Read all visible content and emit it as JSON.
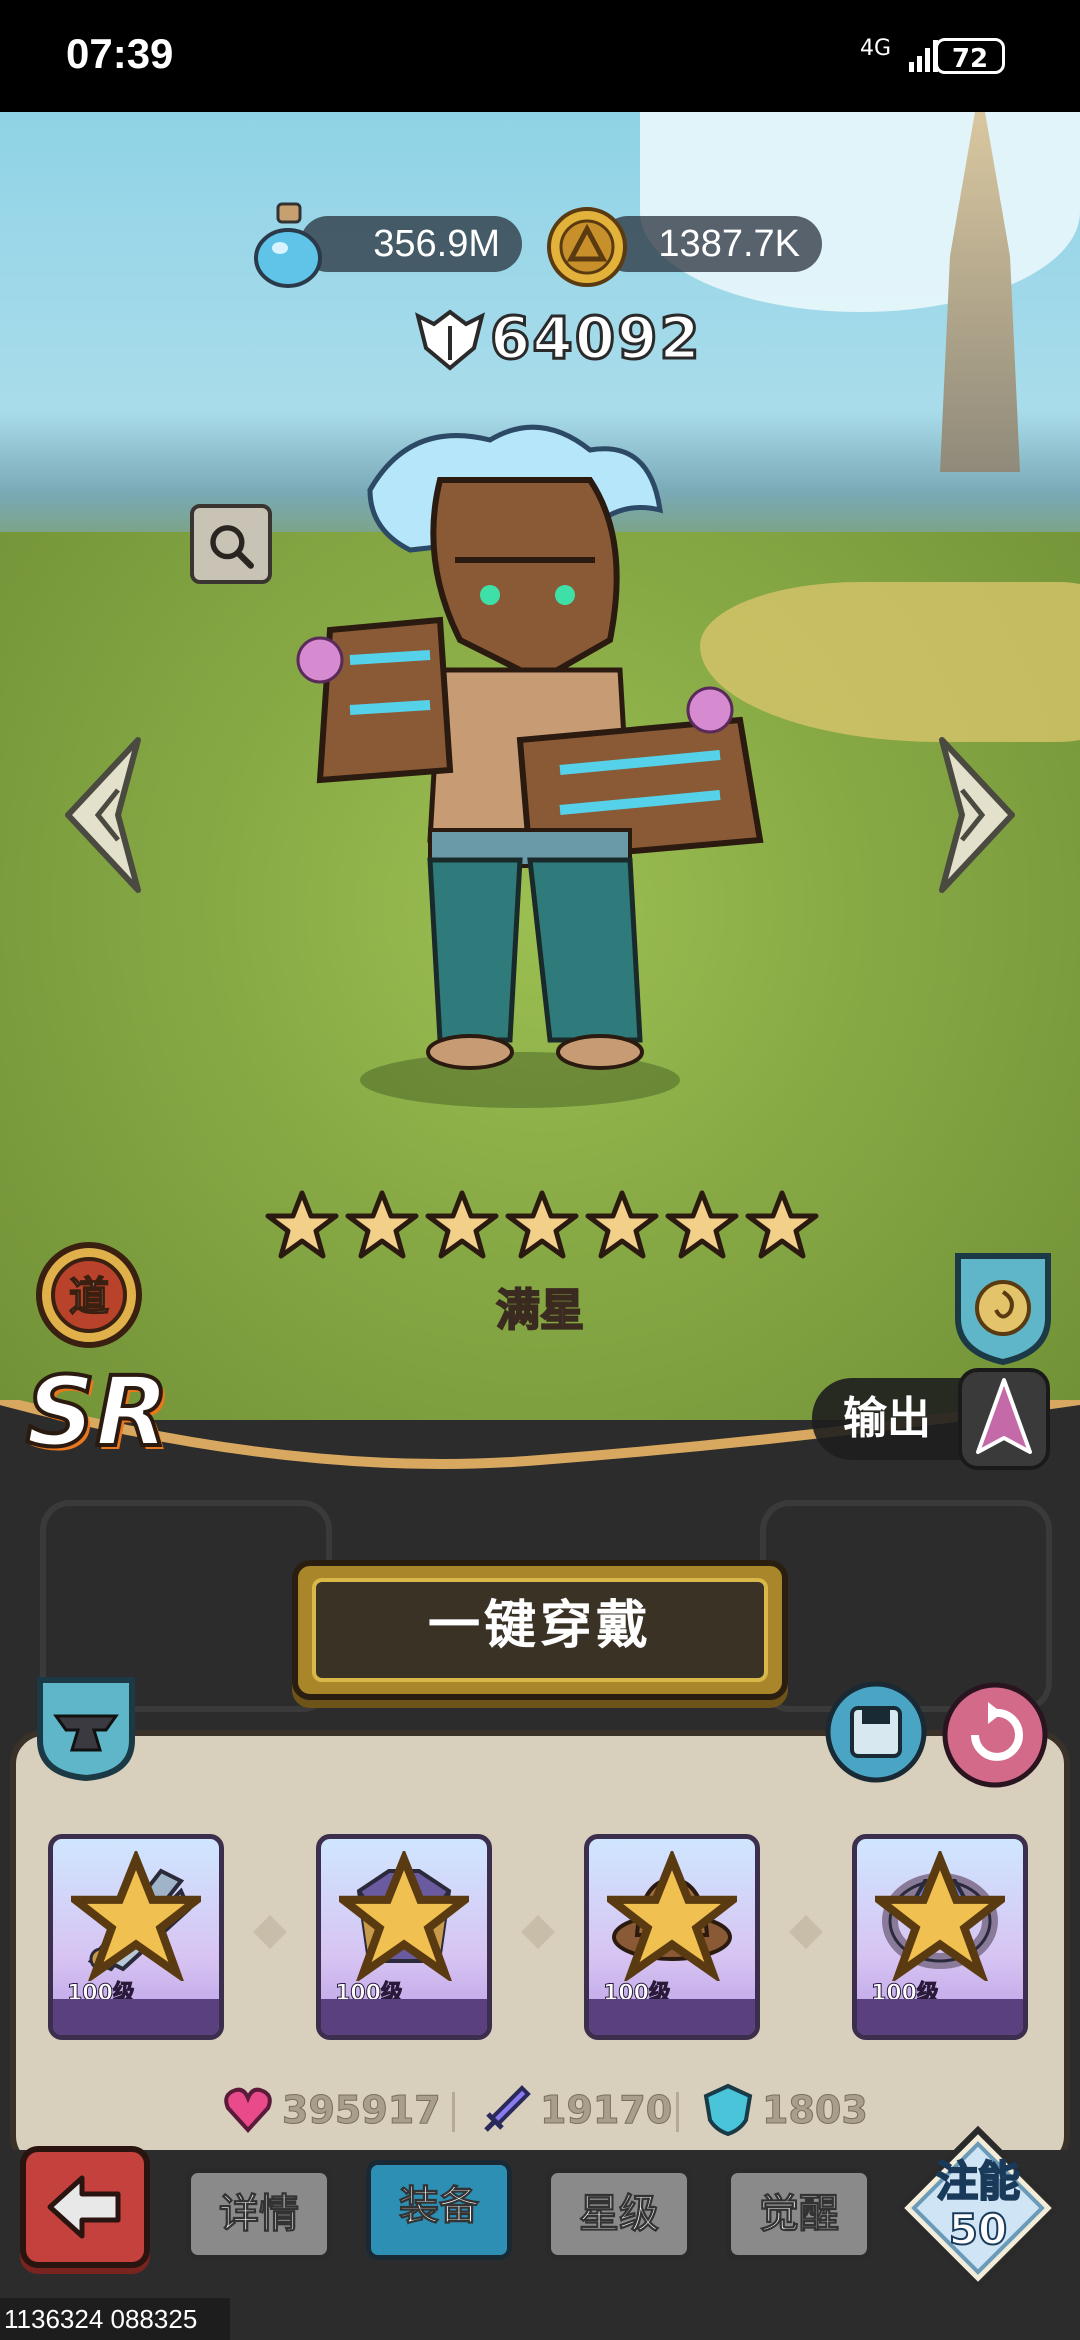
{
  "status_bar": {
    "time": "07:39",
    "network": "4G",
    "battery": "72"
  },
  "currencies": {
    "potion_icon": "potion-icon",
    "potion_value": "356.9M",
    "coin_icon": "coin-icon",
    "coin_value": "1387.7K"
  },
  "power": {
    "icon": "power-icon",
    "value": "64092"
  },
  "hero": {
    "star_count": 7,
    "star_label": "满星",
    "faction_badge": "道",
    "rarity": "SR",
    "role_label": "输出"
  },
  "actions": {
    "one_click_equip": "一键穿戴"
  },
  "equipment": [
    {
      "icon": "twin-blades-icon",
      "level": "100级",
      "stars": 1
    },
    {
      "icon": "armor-icon",
      "level": "100级",
      "stars": 1
    },
    {
      "icon": "hat-icon",
      "level": "100级",
      "stars": 1
    },
    {
      "icon": "gem-ring-icon",
      "level": "100级",
      "stars": 1
    }
  ],
  "stats": {
    "hp_icon": "heart-icon",
    "hp": "395917",
    "atk_icon": "sword-icon",
    "atk": "19170",
    "def_icon": "shield-icon",
    "def": "1803"
  },
  "tabs": {
    "details": "详情",
    "equip": "装备",
    "star": "星级",
    "awaken": "觉醒"
  },
  "empower": {
    "label": "注能",
    "value": "50"
  },
  "footer_id": "1136324 088325",
  "colors": {
    "accent_gold": "#a9862a",
    "tab_active": "#2d8fb3",
    "back_red": "#c4413d"
  }
}
